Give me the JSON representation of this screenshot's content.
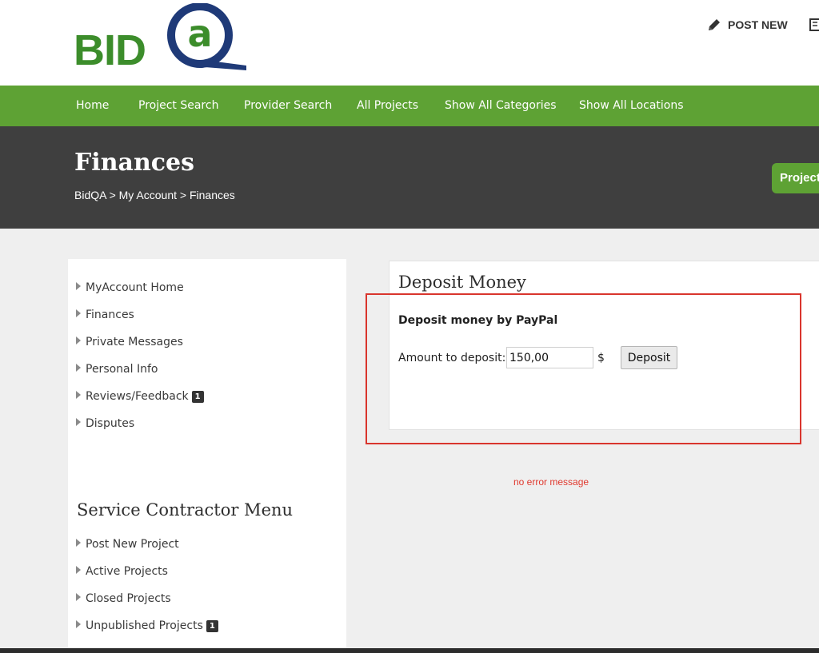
{
  "header": {
    "logo_text": "BIDQA",
    "logo_bid": "BID",
    "post_new_label": "POST NEW",
    "colors": {
      "brand_green": "#3c8d2b",
      "brand_navy": "#1f3a78",
      "nav_green": "#5ea234"
    }
  },
  "nav": {
    "items": [
      {
        "label": "Home"
      },
      {
        "label": "Project Search"
      },
      {
        "label": "Provider Search"
      },
      {
        "label": "All Projects"
      },
      {
        "label": "Show All Categories"
      },
      {
        "label": "Show All Locations"
      }
    ]
  },
  "banner": {
    "title": "Finances",
    "breadcrumb": "BidQA > My Account > Finances",
    "project_button_label": "Project"
  },
  "sidebar": {
    "account_items": [
      {
        "label": "MyAccount Home"
      },
      {
        "label": "Finances"
      },
      {
        "label": "Private Messages"
      },
      {
        "label": "Personal Info"
      },
      {
        "label": "Reviews/Feedback",
        "badge": "1"
      },
      {
        "label": "Disputes"
      }
    ],
    "contractor_heading": "Service Contractor Menu",
    "contractor_items": [
      {
        "label": "Post New Project"
      },
      {
        "label": "Active Projects"
      },
      {
        "label": "Closed Projects"
      },
      {
        "label": "Unpublished Projects",
        "badge": "1"
      }
    ]
  },
  "deposit": {
    "title": "Deposit Money",
    "subtitle": "Deposit money by PayPal",
    "amount_label": "Amount to deposit:",
    "amount_value": "150,00",
    "currency": "$",
    "button_label": "Deposit"
  },
  "status": {
    "error_text": "no error message",
    "error_color": "#e0392e"
  },
  "icons": {
    "post_new": "pencil-icon",
    "news": "newspaper-icon",
    "side_arrow": "triangle-right-icon"
  }
}
